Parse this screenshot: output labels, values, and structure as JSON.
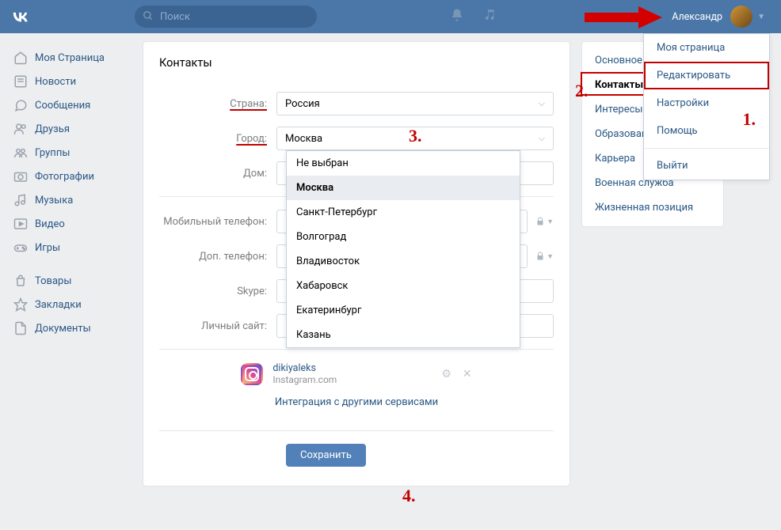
{
  "header": {
    "search_placeholder": "Поиск",
    "user_name": "Александр"
  },
  "sidebar": {
    "items": [
      "Моя Страница",
      "Новости",
      "Сообщения",
      "Друзья",
      "Группы",
      "Фотографии",
      "Музыка",
      "Видео",
      "Игры"
    ],
    "items2": [
      "Товары",
      "Закладки",
      "Документы"
    ]
  },
  "dropdown": {
    "items": [
      "Моя страница",
      "Редактировать",
      "Настройки",
      "Помощь",
      "Выйти"
    ]
  },
  "form": {
    "title": "Контакты",
    "labels": {
      "country": "Страна:",
      "city": "Город:",
      "home": "Дом:",
      "mobile": "Мобильный телефон:",
      "alt_phone": "Доп. телефон:",
      "skype": "Skype:",
      "site": "Личный сайт:"
    },
    "country_value": "Россия",
    "city_value": "Москва",
    "city_options": [
      "Не выбран",
      "Москва",
      "Санкт-Петербург",
      "Волгоград",
      "Владивосток",
      "Хабаровск",
      "Екатеринбург",
      "Казань"
    ],
    "instagram": {
      "name": "dikiyaleks",
      "domain": "Instagram.com"
    },
    "integration_link": "Интеграция с другими сервисами",
    "save": "Сохранить"
  },
  "tabs": {
    "items": [
      "Основное",
      "Контакты",
      "Интересы",
      "Образование",
      "Карьера",
      "Военная служба",
      "Жизненная позиция"
    ]
  },
  "annotations": {
    "a1": "1.",
    "a2": "2.",
    "a3": "3.",
    "a4": "4."
  }
}
